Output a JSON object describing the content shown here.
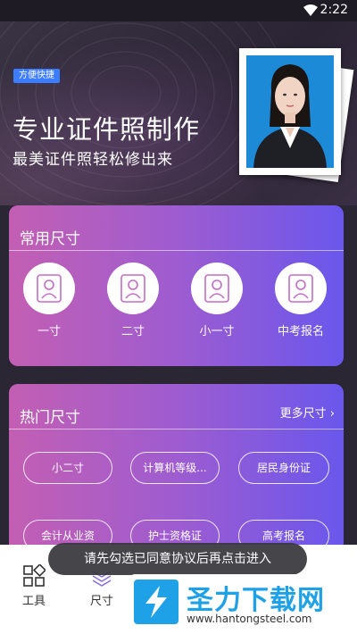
{
  "status_bar": {
    "time": "2:22"
  },
  "hero": {
    "badge": "方便快捷",
    "title": "专业证件照制作",
    "subtitle": "最美证件照轻松修出来"
  },
  "common_sizes": {
    "title": "常用尺寸",
    "items": [
      {
        "label": "一寸",
        "icon": "person-card-icon"
      },
      {
        "label": "二寸",
        "icon": "person-card-icon"
      },
      {
        "label": "小一寸",
        "icon": "person-card-icon"
      },
      {
        "label": "中考报名",
        "icon": "person-card-icon"
      }
    ]
  },
  "hot_sizes": {
    "title": "热门尺寸",
    "more_label": "更多尺寸",
    "pills": [
      "小二寸",
      "计算机等级...",
      "居民身份证",
      "会计从业资",
      "护士资格证",
      "高考报名"
    ]
  },
  "tabbar": {
    "items": [
      {
        "label": "工具",
        "icon": "grid-icon"
      },
      {
        "label": "尺寸",
        "icon": "layers-icon"
      }
    ]
  },
  "toast": {
    "text": "请先勾选已同意协议后再点击进入"
  },
  "watermark": {
    "title": "圣力下载网",
    "url": "www.hantongsteel.com"
  },
  "colors": {
    "accent_blue": "#3c7cff",
    "panel_pink": "#c35fb3",
    "panel_violet": "#6a57ec",
    "photo_bg": "#1d8ad8"
  }
}
